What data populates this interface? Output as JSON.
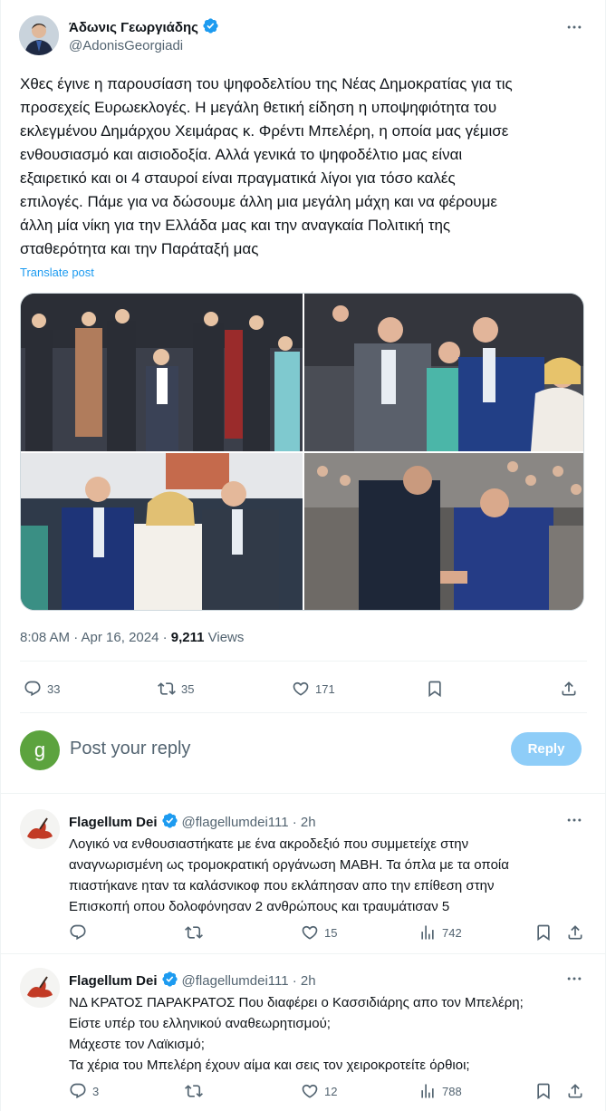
{
  "tweet": {
    "author_name": "Άδωνις Γεωργιάδης",
    "author_handle": "@AdonisGeorgiadi",
    "text": "Χθες έγινε η παρουσίαση του ψηφοδελτίου της Νέας Δημοκρατίας για τις\nπροσεχείς Ευρωεκλογές. Η μεγάλη θετική είδηση η υποψηφιότητα του\nεκλεγμένου Δημάρχου Χειμάρας κ. Φρέντι Μπελέρη, η οποία μας γέμισε\nενθουσιασμό και αισιοδοξία. Αλλά γενικά το ψηφοδέλτιο μας είναι\nεξαιρετικό και οι 4 σταυροί είναι πραγματικά λίγοι για τόσο καλές\nεπιλογές. Πάμε για να δώσουμε άλλη μια μεγάλη μάχη και να φέρουμε\nάλλη μία νίκη για την Ελλάδα μας και την αναγκαία Πολιτική της\nσταθερότητα και την Παράταξή μας",
    "translate_label": "Translate post",
    "time": "8:08 AM · Apr 16, 2024 · ",
    "views_count": "9,211",
    "views_label": " Views",
    "replies": "33",
    "reposts": "35",
    "likes": "171"
  },
  "reply_box": {
    "avatar_letter": "g",
    "placeholder": "Post your reply",
    "button": "Reply"
  },
  "replies": [
    {
      "name": "Flagellum Dei",
      "handle": "@flagellumdei111 · 2h",
      "text": "Λογικό να ενθουσιαστήκατε με ένα ακροδεξιό που συμμετείχε στην\nαναγνωρισμένη ως τρομοκρατική οργάνωση ΜΑΒΗ. Τα όπλα με τα οποία\nπιαστήκανε ηταν τα καλάσνικοφ που εκλάπησαν απο την επίθεση στην\nΕπισκοπή οπου δολοφόνησαν 2 ανθρώπους και τραυμάτισαν 5",
      "replies": "",
      "reposts": "",
      "likes": "15",
      "views": "742"
    },
    {
      "name": "Flagellum Dei",
      "handle": "@flagellumdei111 · 2h",
      "text": "ΝΔ ΚΡΑΤΟΣ ΠΑΡΑΚΡΑΤΟΣ Που διαφέρει ο Κασσιδιάρης απο τον Μπελέρη;\nΕίστε υπέρ του ελληνικού αναθεωρητισμού;\nΜάχεστε τον Λαϊκισμό;\nΤα χέρια του Μπελέρη έχουν αίμα και σεις τον χειροκροτείτε όρθιοι;",
      "replies": "3",
      "reposts": "",
      "likes": "12",
      "views": "788"
    }
  ],
  "colors": {
    "accent": "#1d9bf0",
    "reply_button": "#8ecdf8",
    "secondary_text": "#536471",
    "avatar_green": "#5ca33e"
  },
  "icons": [
    "verified-badge-icon",
    "more-icon",
    "reply-icon",
    "repost-icon",
    "like-icon",
    "bookmark-icon",
    "share-icon",
    "views-icon"
  ]
}
